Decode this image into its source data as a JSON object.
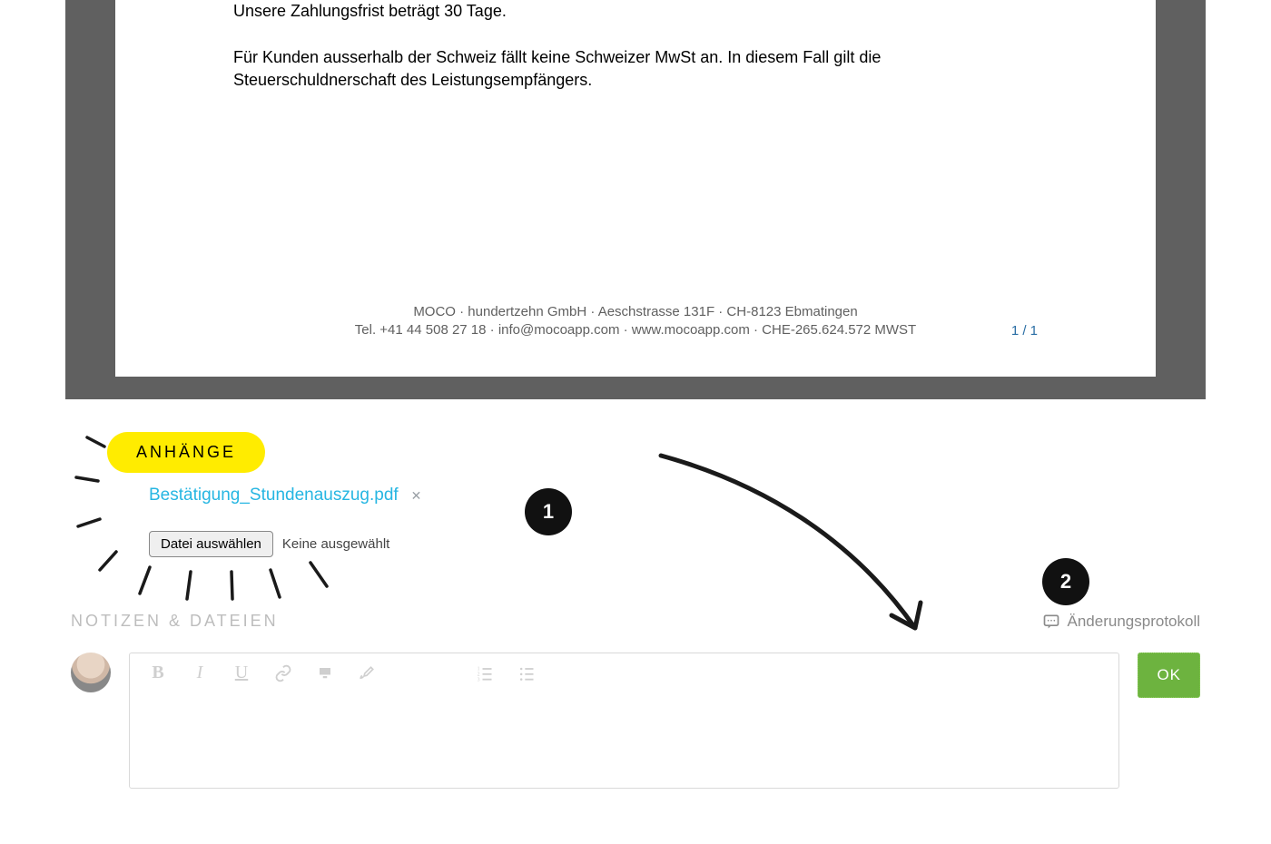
{
  "document": {
    "body_line1": "Unsere Zahlungsfrist beträgt 30 Tage.",
    "body_line2": "Für Kunden ausserhalb der Schweiz fällt keine Schweizer MwSt an. In diesem Fall gilt die Steuerschuldnerschaft des Leistungsempfängers.",
    "footer_line1": "MOCO · hundertzehn GmbH · Aeschstrasse 131F · CH-8123 Ebmatingen",
    "footer_line2": "Tel. +41 44 508 27 18 · info@mocoapp.com · www.mocoapp.com · CHE-265.624.572 MWST",
    "page_number": "1 / 1"
  },
  "attachments": {
    "header": "ANHÄNGE",
    "file_name": "Bestätigung_Stundenauszug.pdf",
    "choose_button": "Datei auswählen",
    "no_file_text": "Keine ausgewählt"
  },
  "callouts": {
    "one": "1",
    "two": "2"
  },
  "notes": {
    "header": "NOTIZEN & DATEIEN",
    "changelog": "Änderungsprotokoll",
    "ok_button": "OK"
  }
}
